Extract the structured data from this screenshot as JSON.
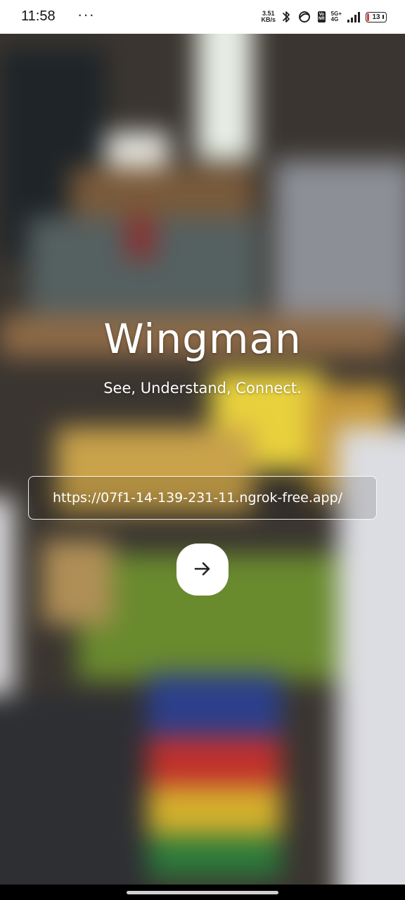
{
  "status_bar": {
    "time": "11:58",
    "more": "···",
    "net_speed_value": "3.51",
    "net_speed_unit": "KB/s",
    "vo_top": "Vo",
    "vo_bottom": "NR",
    "network_top": "5G+",
    "network_bottom": "4G",
    "battery_level": "13",
    "battery_color": "#e53935",
    "icons": [
      "bluetooth-icon",
      "link-icon",
      "volte-icon",
      "signal-icon",
      "battery-icon"
    ]
  },
  "main": {
    "title": "Wingman",
    "subtitle": "See, Understand, Connect.",
    "url_value": "https://07f1-14-139-231-11.ngrok-free.app/",
    "go_icon": "arrow-right-icon"
  },
  "colors": {
    "text": "#ffffff",
    "button_bg": "#ffffff",
    "arrow": "#222222"
  }
}
